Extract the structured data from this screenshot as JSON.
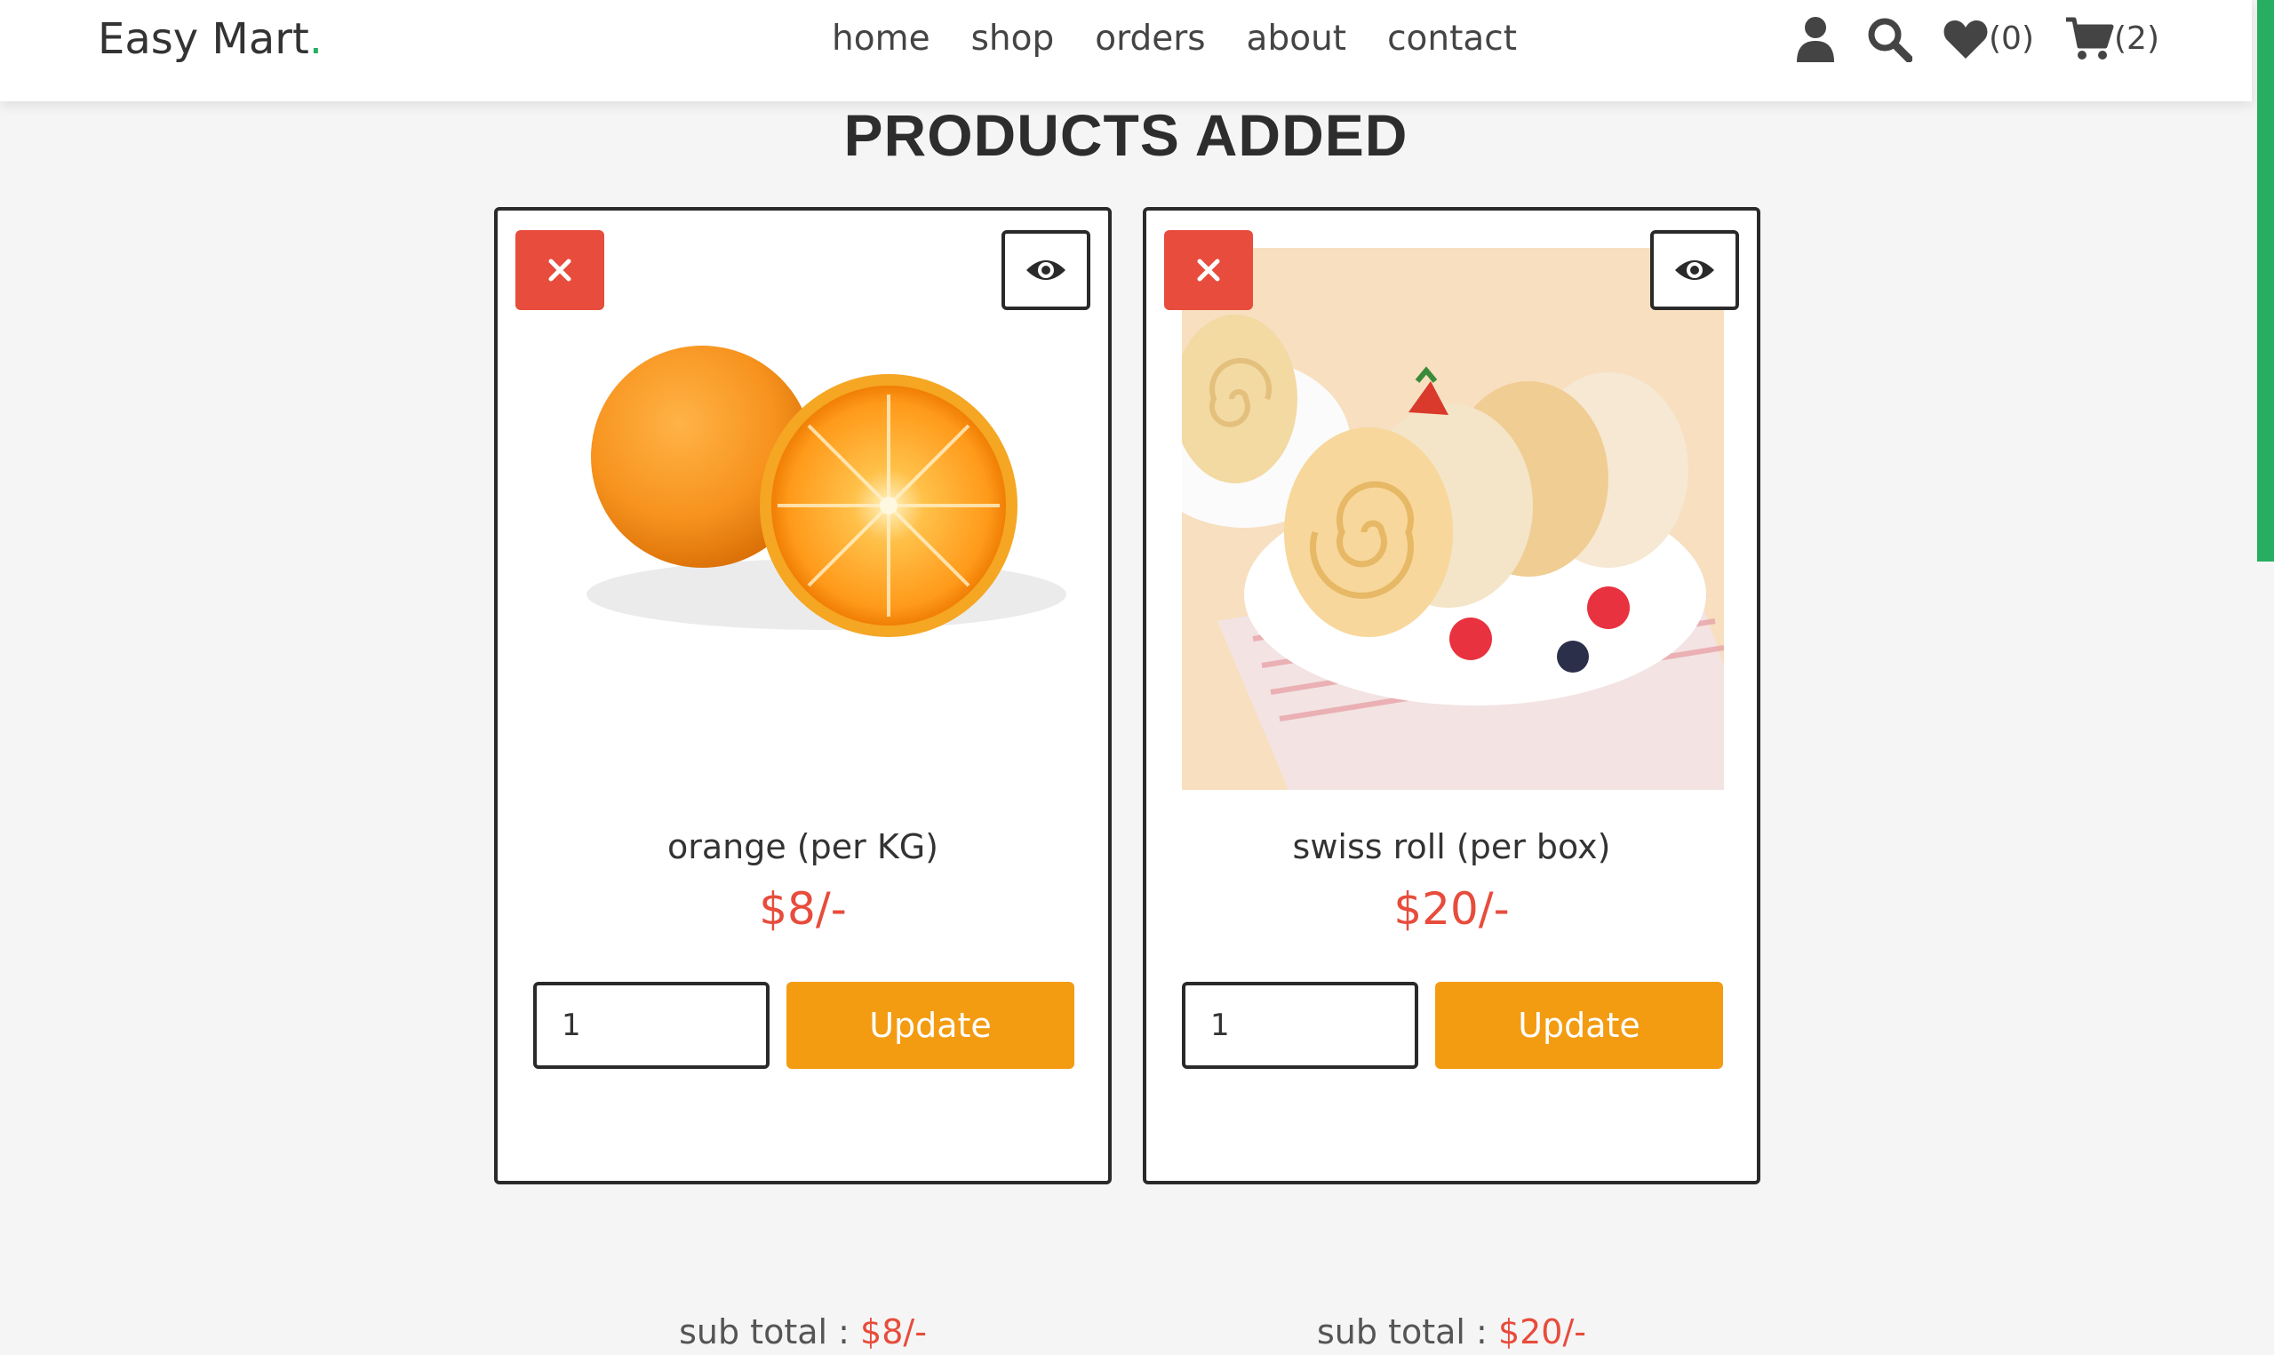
{
  "header": {
    "logo_text": "Easy Mart",
    "logo_dot": ".",
    "nav": [
      "home",
      "shop",
      "orders",
      "about",
      "contact"
    ],
    "wishlist_count": "(0)",
    "cart_count": "(2)"
  },
  "page_title": "PRODUCTS ADDED",
  "products": [
    {
      "name": "orange (per KG)",
      "price": "$8/-",
      "quantity": "1",
      "update_label": "Update",
      "subtotal_label": "sub total : ",
      "subtotal_value": "$8/-",
      "image_icon": "orange-image"
    },
    {
      "name": "swiss roll (per box)",
      "price": "$20/-",
      "quantity": "1",
      "update_label": "Update",
      "subtotal_label": "sub total : ",
      "subtotal_value": "$20/-",
      "image_icon": "swiss-roll-image"
    }
  ],
  "colors": {
    "accent_green": "#27ae60",
    "price_red": "#e74c3c",
    "remove_red": "#e74c3c",
    "update_orange": "#f39c12"
  }
}
